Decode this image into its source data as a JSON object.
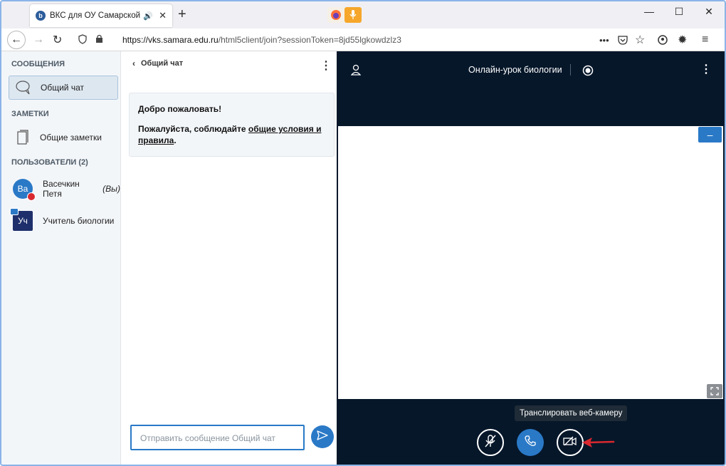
{
  "browser": {
    "tab_title": "ВКС для ОУ Самарской об",
    "favicon_letter": "b",
    "url_host": "https://vks.samara.edu.ru",
    "url_path": "/html5client/join?sessionToken=8jd55lgkowdzlz3"
  },
  "sidebar": {
    "messages_heading": "СООБЩЕНИЯ",
    "public_chat_label": "Общий чат",
    "notes_heading": "ЗАМЕТКИ",
    "shared_notes_label": "Общие заметки",
    "users_heading": "ПОЛЬЗОВАТЕЛИ (2)",
    "users": [
      {
        "initials": "Ва",
        "name": "Васечкин Петя",
        "suffix": "(Вы)"
      },
      {
        "initials": "Уч",
        "name": "Учитель биологии",
        "suffix": ""
      }
    ]
  },
  "chat": {
    "header": "Общий чат",
    "welcome_title": "Добро пожаловать!",
    "welcome_text_before": "Пожалуйста, соблюдайте ",
    "welcome_link": "общие условия и правила",
    "welcome_text_after": ".",
    "input_placeholder": "Отправить сообщение Общий чат"
  },
  "presentation": {
    "title": "Онлайн-урок биологии",
    "minimize_label": "–",
    "tooltip": "Транслировать веб-камеру"
  },
  "colors": {
    "accent": "#2a79c7",
    "dark_bg": "#06172a",
    "arrow": "#d9282f"
  }
}
